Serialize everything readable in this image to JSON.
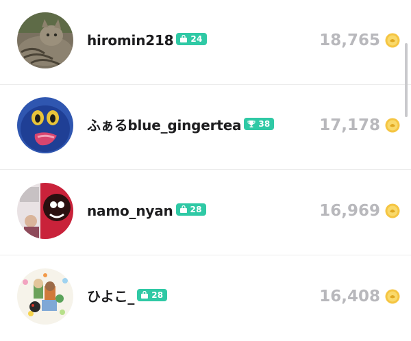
{
  "ranking": {
    "entries": [
      {
        "username": "hiromin218",
        "level": "24",
        "level_icon": "shopping-bag-icon",
        "score": "18,765"
      },
      {
        "username": "ふぁるblue_gingertea",
        "level": "38",
        "level_icon": "trophy-icon",
        "score": "17,178"
      },
      {
        "username": "namo_nyan",
        "level": "28",
        "level_icon": "shopping-bag-icon",
        "score": "16,969"
      },
      {
        "username": "ひよこ_",
        "level": "28",
        "level_icon": "shopping-bag-icon",
        "score": "16,408"
      }
    ]
  },
  "colors": {
    "badge_bg": "#2fc9a5",
    "score_text": "#b8b8bc",
    "coin_gold": "#f5c542",
    "divider": "#ececec"
  },
  "icons": {
    "coin": "coin-icon"
  }
}
